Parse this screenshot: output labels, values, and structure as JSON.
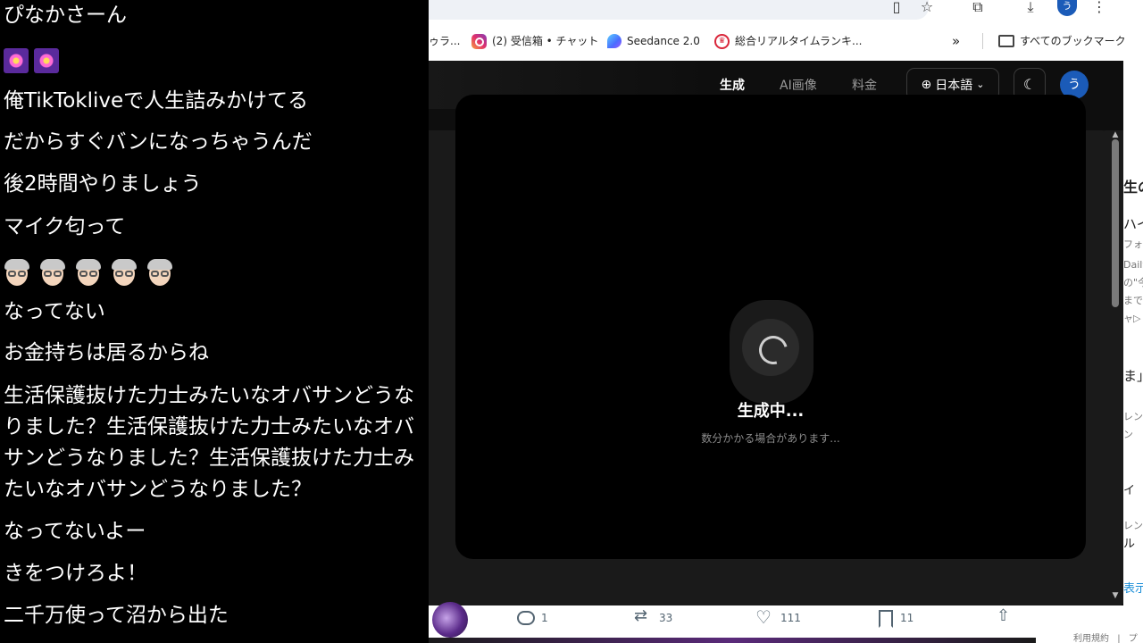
{
  "chat": {
    "messages": [
      {
        "text": "ぴなかさーん"
      },
      {
        "text": "",
        "emoji": "fireworks-x2"
      },
      {
        "text": "俺TikTokliveで人生詰みかけてる"
      },
      {
        "text": "だからすぐバンになっちゃうんだ"
      },
      {
        "text": "後2時間やりましょう"
      },
      {
        "text": "マイク匂って"
      },
      {
        "text": "",
        "emoji": "oldman-x5"
      },
      {
        "text": "なってない"
      },
      {
        "text": "お金持ちは居るからね"
      },
      {
        "text": "生活保護抜けた力士みたいなオバサンどうなりました？生活保護抜けた力士みたいなオバサンどうなりました？生活保護抜けた力士みたいなオバサンどうなりました？"
      },
      {
        "text": "なってないよー"
      },
      {
        "text": "きをつけろよ！"
      },
      {
        "text": "二千万使って沼から出た"
      }
    ]
  },
  "browser": {
    "toolbar": {
      "profile_initial": "う"
    },
    "bookmarks": [
      {
        "label": "ゥラ..."
      },
      {
        "label": "(2) 受信箱 • チャット",
        "icon": "instagram-icon"
      },
      {
        "label": "Seedance 2.0",
        "icon": "seedance-icon"
      },
      {
        "label": "総合リアルタイムランキ...",
        "icon": "ranking-icon"
      },
      {
        "label": "»"
      },
      {
        "label": "すべてのブックマーク",
        "icon": "folder-icon"
      }
    ]
  },
  "app": {
    "nav": {
      "links": [
        "生成",
        "AI画像",
        "料金"
      ],
      "active": "生成",
      "language": "日本語",
      "avatar_initial": "う"
    },
    "generating": {
      "title": "生成中...",
      "subtitle": "数分かかる場合があります..."
    }
  },
  "tweet": {
    "replies": "1",
    "retweets": "33",
    "likes": "111",
    "bookmarks": "11"
  },
  "side_fragments": [
    "生の",
    "ハイ",
    "フォ",
    "Daily",
    "の\"今",
    "まで",
    "ャ▷",
    "ま」",
    "レン",
    "ン",
    "イ",
    "レン",
    "ル",
    "表示"
  ],
  "footer": {
    "terms": "利用規約",
    "sep": "|",
    "more": "プ"
  },
  "colors": {
    "app_bg": "#0e0e0e",
    "panel_bg": "#1a1a1a",
    "avatar_blue": "#1b5bb8",
    "ranking_red": "#d9263a"
  }
}
